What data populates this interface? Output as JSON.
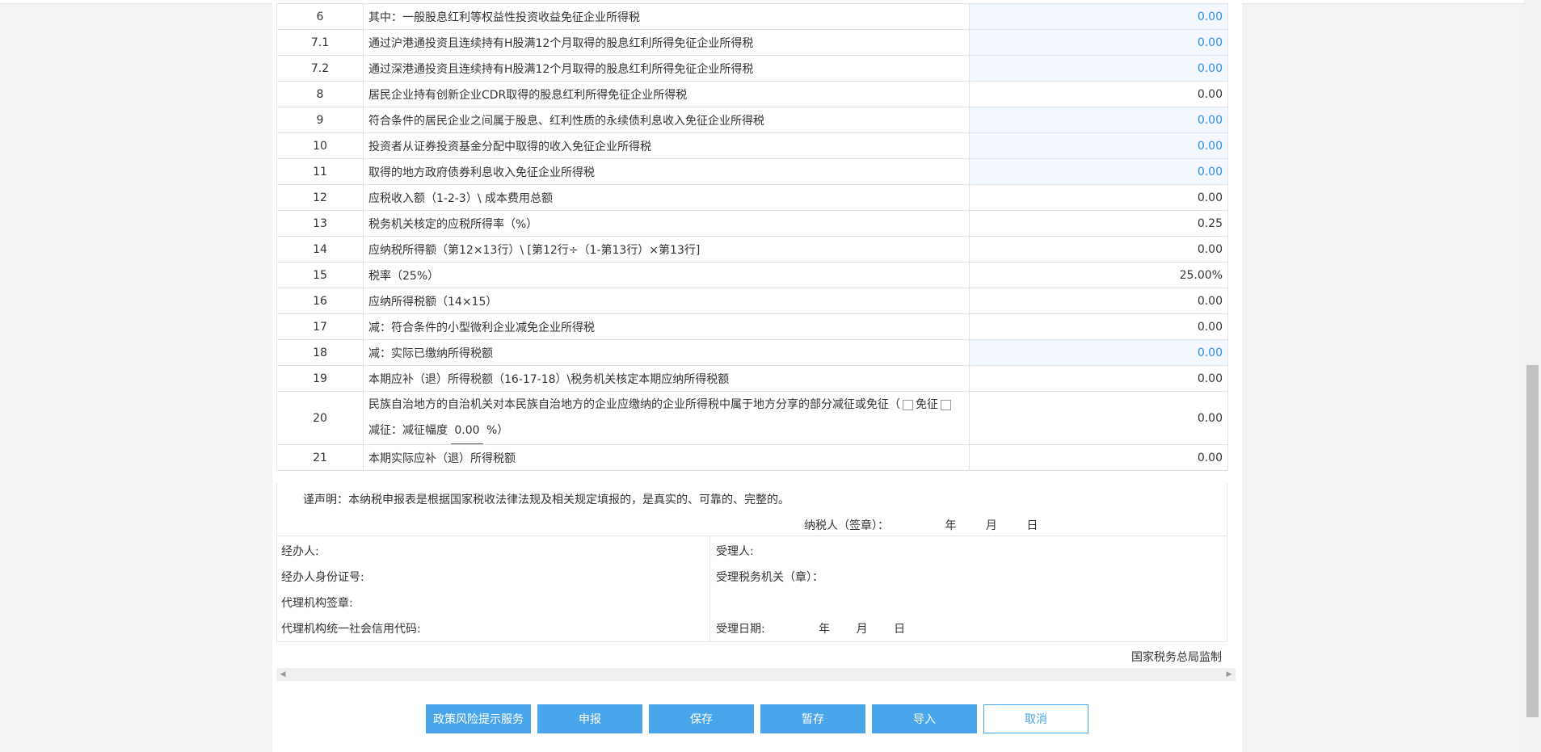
{
  "rows": [
    {
      "num": "6",
      "item": "其中：一般股息红利等权益性投资收益免征企业所得税",
      "value": "0.00",
      "editable": true
    },
    {
      "num": "7.1",
      "item": "通过沪港通投资且连续持有H股满12个月取得的股息红利所得免征企业所得税",
      "value": "0.00",
      "editable": true
    },
    {
      "num": "7.2",
      "item": "通过深港通投资且连续持有H股满12个月取得的股息红利所得免征企业所得税",
      "value": "0.00",
      "editable": true
    },
    {
      "num": "8",
      "item": "居民企业持有创新企业CDR取得的股息红利所得免征企业所得税",
      "value": "0.00",
      "editable": false
    },
    {
      "num": "9",
      "item": "符合条件的居民企业之间属于股息、红利性质的永续债利息收入免征企业所得税",
      "value": "0.00",
      "editable": true
    },
    {
      "num": "10",
      "item": "投资者从证券投资基金分配中取得的收入免征企业所得税",
      "value": "0.00",
      "editable": true
    },
    {
      "num": "11",
      "item": "取得的地方政府债券利息收入免征企业所得税",
      "value": "0.00",
      "editable": true
    },
    {
      "num": "12",
      "item": "应税收入额（1-2-3）\\ 成本费用总额",
      "value": "0.00",
      "editable": false
    },
    {
      "num": "13",
      "item": "税务机关核定的应税所得率（%）",
      "value": "0.25",
      "editable": false
    },
    {
      "num": "14",
      "item": "应纳税所得额（第12×13行）\\ [第12行÷（1-第13行）×第13行]",
      "value": "0.00",
      "editable": false
    },
    {
      "num": "15",
      "item": "税率（25%）",
      "value": "25.00%",
      "editable": false
    },
    {
      "num": "16",
      "item": "应纳所得税额（14×15）",
      "value": "0.00",
      "editable": false
    },
    {
      "num": "17",
      "item": "减：符合条件的小型微利企业减免企业所得税",
      "value": "0.00",
      "editable": false
    },
    {
      "num": "18",
      "item": "减：实际已缴纳所得税额",
      "value": "0.00",
      "editable": true
    },
    {
      "num": "19",
      "item": "本期应补（退）所得税额（16-17-18）\\税务机关核定本期应纳所得税额",
      "value": "0.00",
      "editable": false
    }
  ],
  "row20": {
    "num": "20",
    "text_a": "民族自治地方的自治机关对本民族自治地方的企业应缴纳的企业所得税中属于地方分享的部分减征或免征（",
    "exempt_label": "免征",
    "text_b": "减征：减征幅度",
    "rate_value": "0.00",
    "rate_suffix": "%）",
    "value": "0.00"
  },
  "row21": {
    "num": "21",
    "item": "本期实际应补（退）所得税额",
    "value": "0.00"
  },
  "declaration": {
    "statement": "谨声明：本纳税申报表是根据国家税收法律法规及相关规定填报的，是真实的、可靠的、完整的。",
    "taxpayer_sign": "纳税人（签章）：",
    "year": "年",
    "month": "月",
    "day": "日"
  },
  "signature": {
    "handler": "经办人:",
    "handler_id": "经办人身份证号:",
    "agency_seal": "代理机构签章:",
    "agency_code": "代理机构统一社会信用代码:",
    "receiver": "受理人:",
    "receiving_office": "受理税务机关（章）：",
    "receiving_date": "受理日期:",
    "year": "年",
    "month": "月",
    "day": "日"
  },
  "footnote": "国家税务总局监制",
  "buttons": {
    "policy_risk": "政策风险提示服务",
    "declare": "申报",
    "save": "保存",
    "temp_save": "暂存",
    "import": "导入",
    "cancel": "取消"
  },
  "colors": {
    "primary": "#4aa6ea",
    "editable_bg": "#f2f8fd",
    "editable_text": "#2b8ce0"
  }
}
